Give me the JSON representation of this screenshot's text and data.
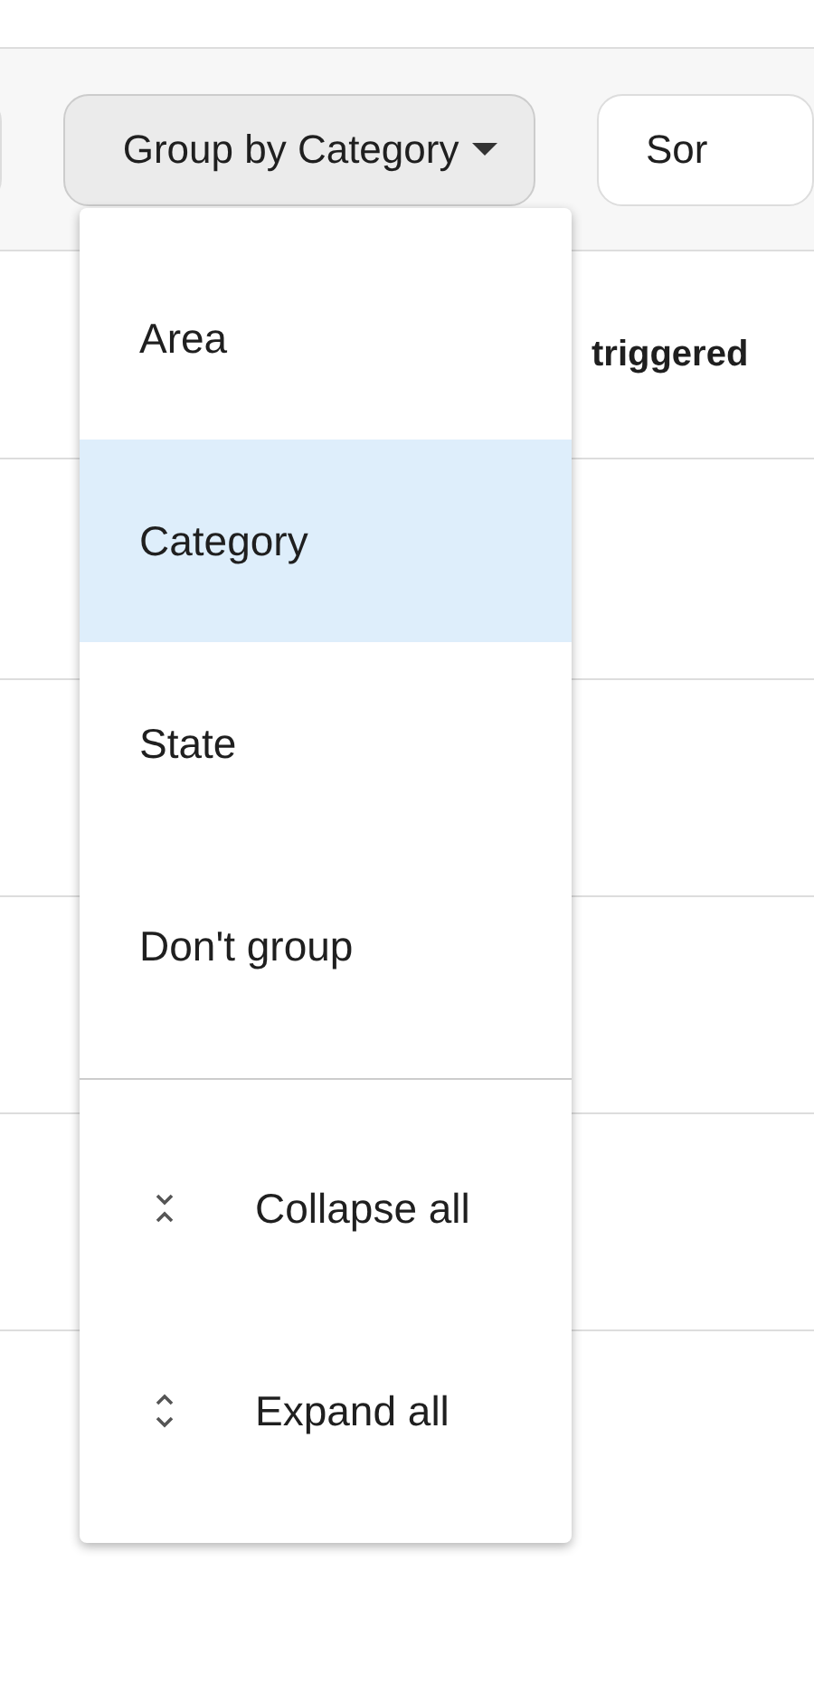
{
  "toolbar": {
    "group_button": {
      "label": "Group by Category"
    },
    "sort_button": {
      "label": "Sor"
    }
  },
  "table_header": {
    "column_text": "triggered"
  },
  "menu": {
    "options": [
      {
        "label": "Area",
        "selected": false
      },
      {
        "label": "Category",
        "selected": true
      },
      {
        "label": "State",
        "selected": false
      },
      {
        "label": "Don't group",
        "selected": false
      }
    ],
    "actions": [
      {
        "kind": "collapse",
        "label": "Collapse all"
      },
      {
        "kind": "expand",
        "label": "Expand all"
      }
    ]
  }
}
